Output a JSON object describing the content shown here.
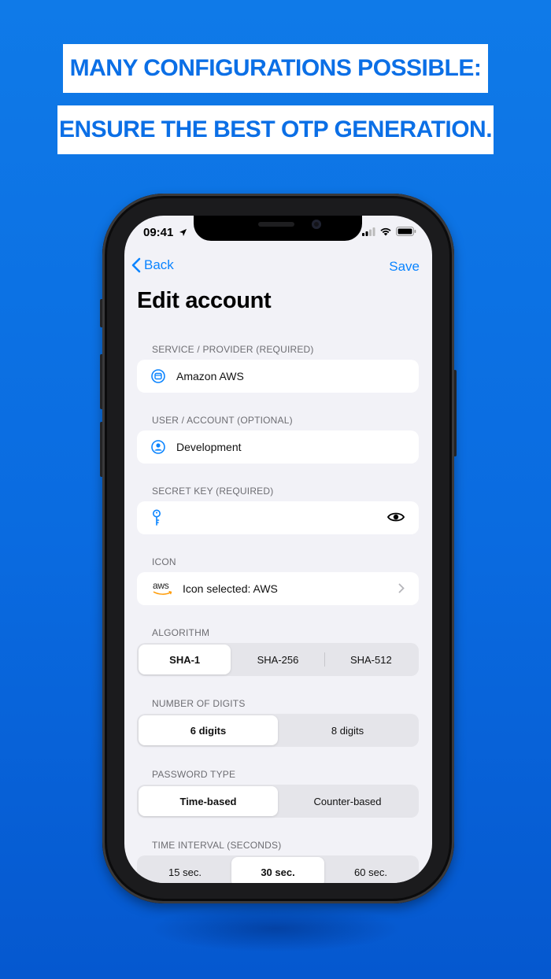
{
  "banners": {
    "line1": "MANY CONFIGURATIONS POSSIBLE:",
    "line2": "ENSURE THE BEST OTP GENERATION."
  },
  "status": {
    "time": "09:41"
  },
  "nav": {
    "back_label": "Back",
    "save_label": "Save",
    "title": "Edit account"
  },
  "form": {
    "service": {
      "label": "SERVICE / PROVIDER (REQUIRED)",
      "value": "Amazon AWS",
      "icon": "app-window-icon"
    },
    "user": {
      "label": "USER / ACCOUNT (OPTIONAL)",
      "value": "Development",
      "icon": "person-circle-icon"
    },
    "secret": {
      "label": "SECRET KEY (REQUIRED)",
      "value": "",
      "icon": "key-icon"
    },
    "icon": {
      "label": "ICON",
      "value": "Icon selected: AWS",
      "logo_text": "aws"
    },
    "algorithm": {
      "label": "ALGORITHM",
      "options": [
        "SHA-1",
        "SHA-256",
        "SHA-512"
      ],
      "selected": "SHA-1"
    },
    "digits": {
      "label": "NUMBER OF DIGITS",
      "options": [
        "6 digits",
        "8 digits"
      ],
      "selected": "6 digits"
    },
    "password_type": {
      "label": "PASSWORD TYPE",
      "options": [
        "Time-based",
        "Counter-based"
      ],
      "selected": "Time-based"
    },
    "interval": {
      "label": "TIME INTERVAL (SECONDS)",
      "options": [
        "15 sec.",
        "30 sec.",
        "60 sec."
      ],
      "selected": "30 sec."
    }
  },
  "colors": {
    "accent": "#0a84ff",
    "banner_text": "#0b6fe6",
    "background": "#0a6be0"
  }
}
